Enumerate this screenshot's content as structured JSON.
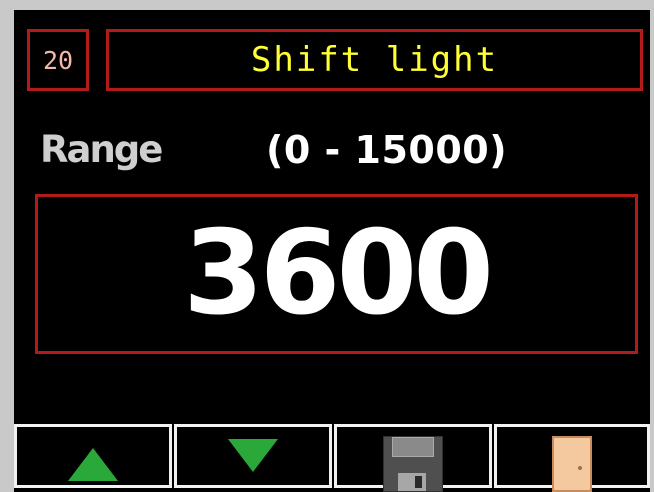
{
  "page_number": "20",
  "title": "Shift light",
  "range": {
    "label": "Range",
    "text": "(0 - 15000)"
  },
  "value": "3600",
  "colors": {
    "background": "#000000",
    "frame": "#b31a1a",
    "title_text": "#ffff33",
    "page_number_text": "#f5b7a8",
    "range_label_text": "#cfcfcf",
    "value_text": "#ffffff",
    "button_border": "#f2f2f2",
    "arrow_green": "#2aa83a",
    "door_color": "#f4c9a0"
  },
  "buttons": [
    {
      "name": "increase-button",
      "icon": "up-arrow-icon"
    },
    {
      "name": "decrease-button",
      "icon": "down-arrow-icon"
    },
    {
      "name": "save-button",
      "icon": "floppy-disk-icon"
    },
    {
      "name": "exit-button",
      "icon": "door-icon"
    }
  ]
}
